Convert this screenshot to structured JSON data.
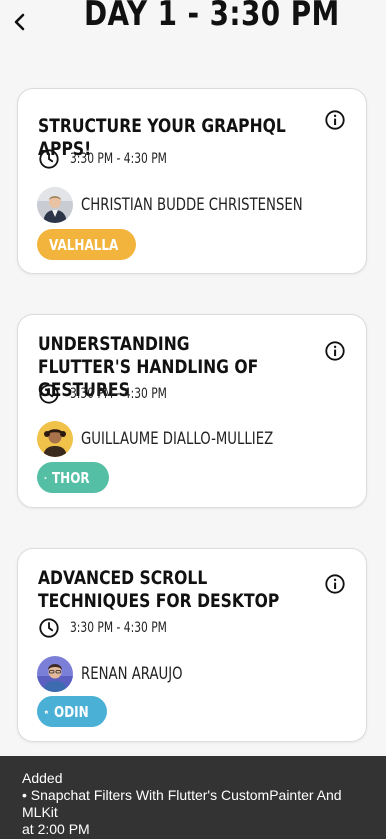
{
  "header": {
    "title": "DAY 1 - 3:30 PM",
    "back_icon": "chevron-left-icon"
  },
  "sessions": [
    {
      "title": "STRUCTURE YOUR GRAPHQL APPS!",
      "time": "3:30 PM - 4:30 PM",
      "speaker": "CHRISTIAN BUDDE CHRISTENSEN",
      "room": "VALHALLA",
      "room_color": "#f2b43c"
    },
    {
      "title": "UNDERSTANDING FLUTTER'S HANDLING OF GESTURES",
      "time": "3:30 PM - 4:30 PM",
      "speaker": "GUILLAUME DIALLO-MULLIEZ",
      "room": "THOR",
      "room_color": "#54bfa4"
    },
    {
      "title": "ADVANCED SCROLL TECHNIQUES FOR DESKTOP",
      "time": "3:30 PM - 4:30 PM",
      "speaker": "RENAN ARAUJO",
      "room": "ODIN",
      "room_color": "#4bb0d6"
    }
  ],
  "snackbar": {
    "line1": "Added",
    "line2": "• Snapchat Filters With Flutter's CustomPainter And MLKit",
    "line3": "at 2:00 PM"
  }
}
